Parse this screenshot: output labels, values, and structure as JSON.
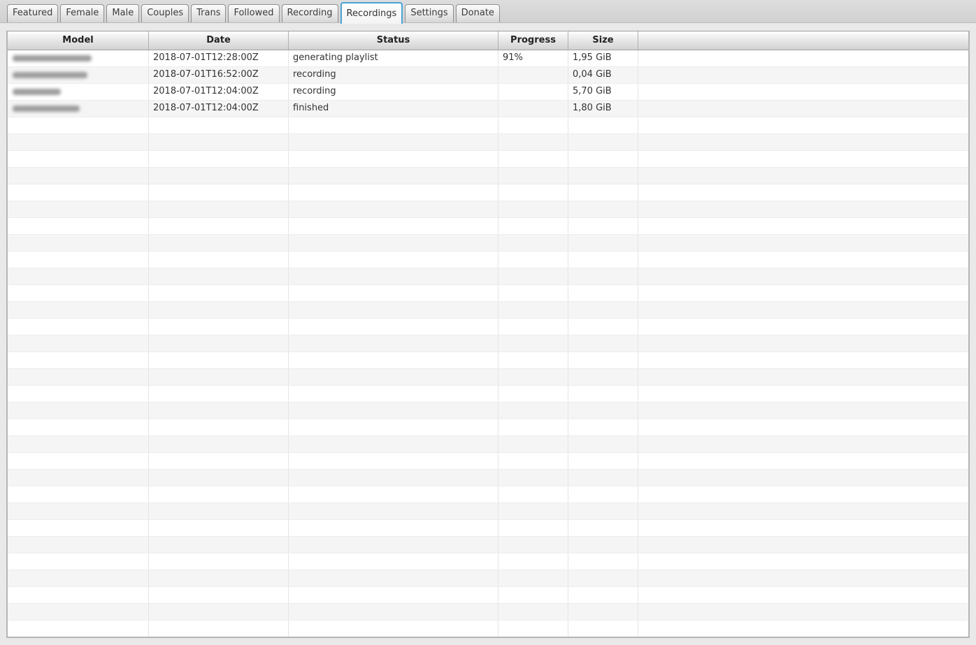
{
  "tabs": {
    "items": [
      {
        "label": "Featured"
      },
      {
        "label": "Female"
      },
      {
        "label": "Male"
      },
      {
        "label": "Couples"
      },
      {
        "label": "Trans"
      },
      {
        "label": "Followed"
      },
      {
        "label": "Recording"
      },
      {
        "label": "Recordings"
      },
      {
        "label": "Settings"
      },
      {
        "label": "Donate"
      }
    ],
    "selected": "Recordings"
  },
  "table": {
    "columns": [
      {
        "key": "model",
        "label": "Model"
      },
      {
        "key": "date",
        "label": "Date"
      },
      {
        "key": "status",
        "label": "Status"
      },
      {
        "key": "progress",
        "label": "Progress"
      },
      {
        "key": "size",
        "label": "Size"
      },
      {
        "key": "filler",
        "label": ""
      }
    ],
    "rows": [
      {
        "model_blurred": true,
        "model_blob_width": 113,
        "date": "2018-07-01T12:28:00Z",
        "status": "generating playlist",
        "progress": "91%",
        "size": "1,95 GiB"
      },
      {
        "model_blurred": true,
        "model_blob_width": 107,
        "date": "2018-07-01T16:52:00Z",
        "status": "recording",
        "progress": "",
        "size": "0,04 GiB"
      },
      {
        "model_blurred": true,
        "model_blob_width": 69,
        "date": "2018-07-01T12:04:00Z",
        "status": "recording",
        "progress": "",
        "size": "5,70 GiB"
      },
      {
        "model_blurred": true,
        "model_blob_width": 96,
        "date": "2018-07-01T12:04:00Z",
        "status": "finished",
        "progress": "",
        "size": "1,80 GiB"
      }
    ],
    "empty_row_slots": 31
  },
  "colors": {
    "selected_tab_border": "#4aa3d8"
  }
}
